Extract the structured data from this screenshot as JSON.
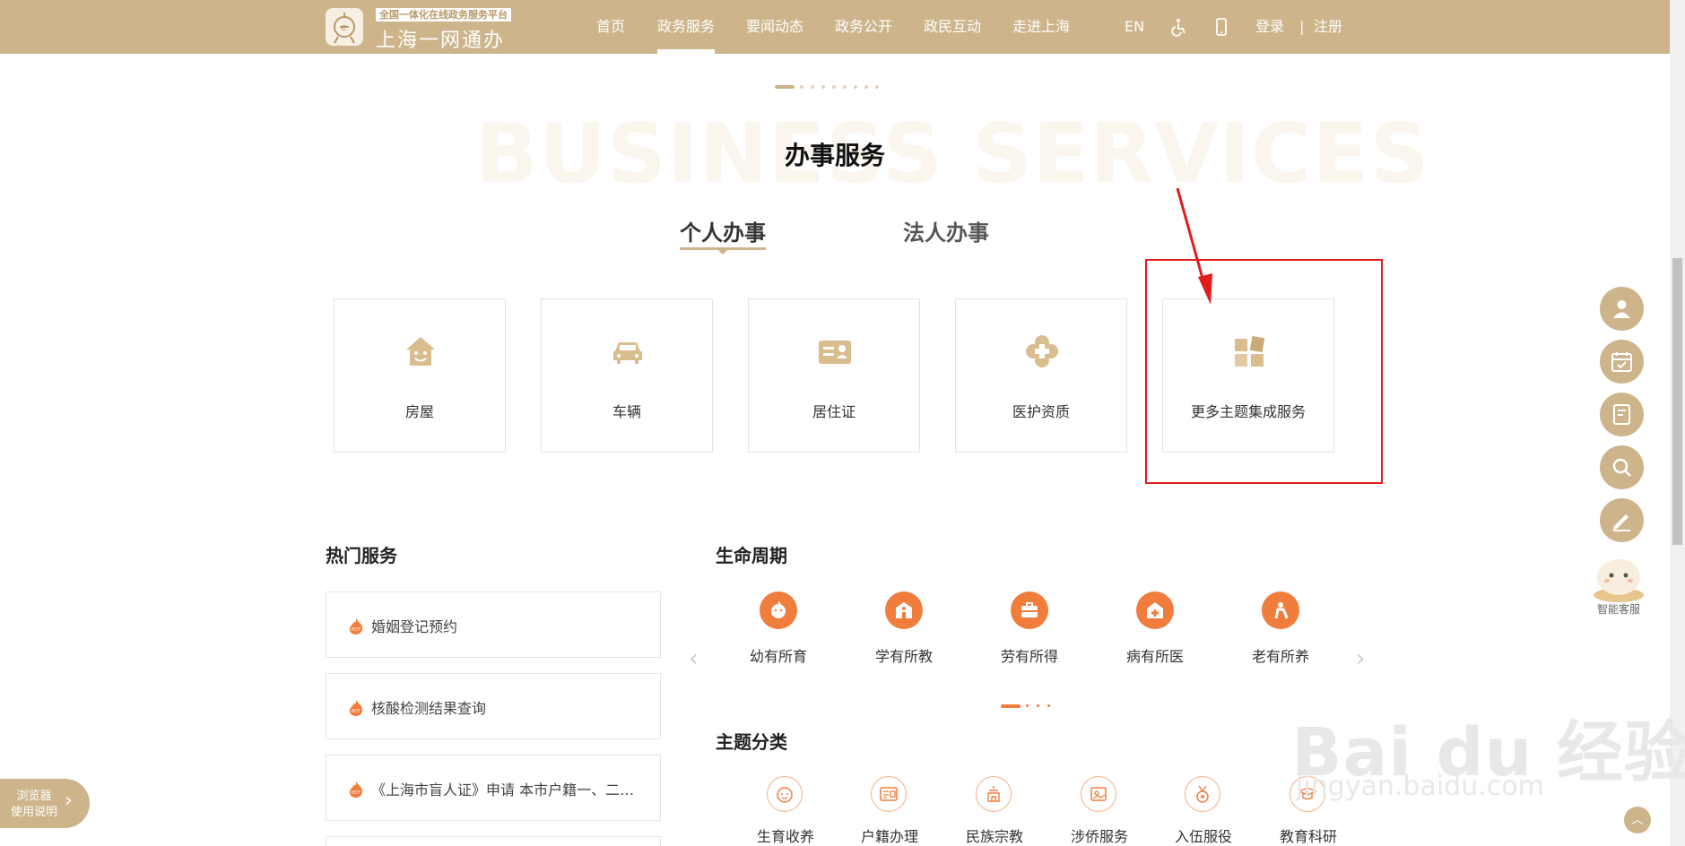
{
  "header": {
    "logo_tag": "全国一体化在线政务服务平台",
    "logo_name": "上海一网通办",
    "nav": [
      "首页",
      "政务服务",
      "要闻动态",
      "政务公开",
      "政民互动",
      "走进上海"
    ],
    "lang": "EN",
    "login": "登录",
    "separator": "|",
    "register": "注册"
  },
  "section": {
    "bg_word": "BUSINESS SERVICES",
    "title": "办事服务",
    "tabs": [
      "个人办事",
      "法人办事"
    ]
  },
  "cards": [
    "房屋",
    "车辆",
    "居住证",
    "医护资质",
    "更多主题集成服务"
  ],
  "hot": {
    "title": "热门服务",
    "items": [
      "婚姻登记预约",
      "核酸检测结果查询",
      "《上海市盲人证》申请 本市户籍一、二…"
    ]
  },
  "life": {
    "title": "生命周期",
    "items": [
      "幼有所育",
      "学有所教",
      "劳有所得",
      "病有所医",
      "老有所养"
    ]
  },
  "themes": {
    "title": "主题分类",
    "items": [
      "生育收养",
      "户籍办理",
      "民族宗教",
      "涉侨服务",
      "入伍服役",
      "教育科研"
    ]
  },
  "float": {
    "bot_label": "智能客服"
  },
  "browser_tip": {
    "line1": "浏览器",
    "line2": "使用说明"
  },
  "watermark": {
    "brand": "Bai du 经验",
    "url": "jingyan.baidu.com"
  },
  "colors": {
    "gold": "#cdb48a",
    "orange": "#f07d3c",
    "highlight": "#e21c1c"
  }
}
